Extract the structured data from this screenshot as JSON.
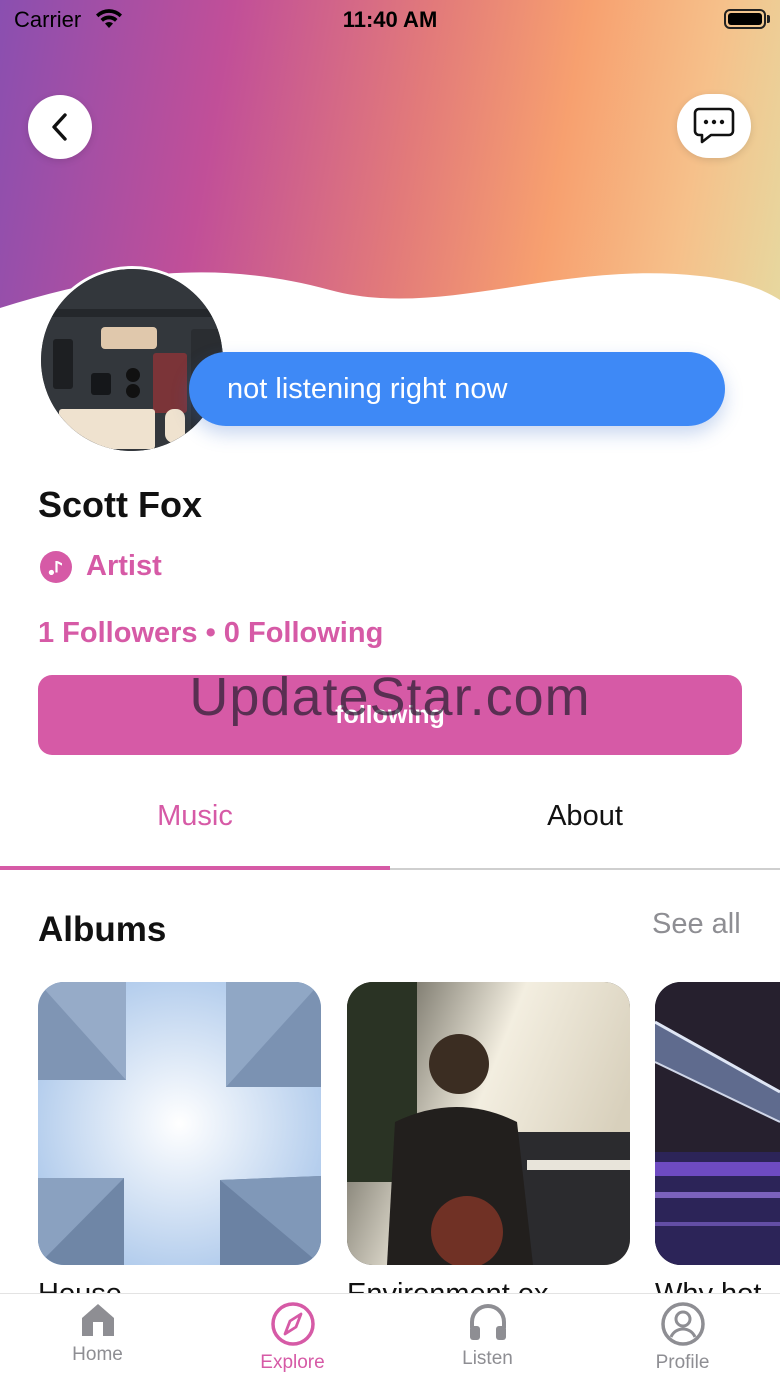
{
  "status_bar": {
    "carrier": "Carrier",
    "time": "11:40 AM"
  },
  "header": {
    "back_icon": "chevron-left-icon",
    "message_icon": "chat-bubble-icon"
  },
  "profile": {
    "status_message": "not listening right now",
    "name": "Scott Fox",
    "role": "Artist",
    "role_icon": "music-note-icon",
    "follow_stats": "1 Followers • 0 Following",
    "follow_button_label": "following",
    "watermark": "UpdateStar.com"
  },
  "tabs": [
    {
      "label": "Music",
      "active": true
    },
    {
      "label": "About",
      "active": false
    }
  ],
  "albums_section": {
    "title": "Albums",
    "see_all": "See all",
    "albums": [
      {
        "title": "House"
      },
      {
        "title": "Environment ex"
      },
      {
        "title": "Why hot"
      }
    ]
  },
  "tab_bar": [
    {
      "label": "Home",
      "icon": "home-icon",
      "active": false
    },
    {
      "label": "Explore",
      "icon": "compass-icon",
      "active": true
    },
    {
      "label": "Listen",
      "icon": "headphones-icon",
      "active": false
    },
    {
      "label": "Profile",
      "icon": "user-circle-icon",
      "active": false
    }
  ],
  "colors": {
    "accent": "#d65aa6",
    "bubble": "#3e89f6",
    "muted": "#8e8e93"
  }
}
